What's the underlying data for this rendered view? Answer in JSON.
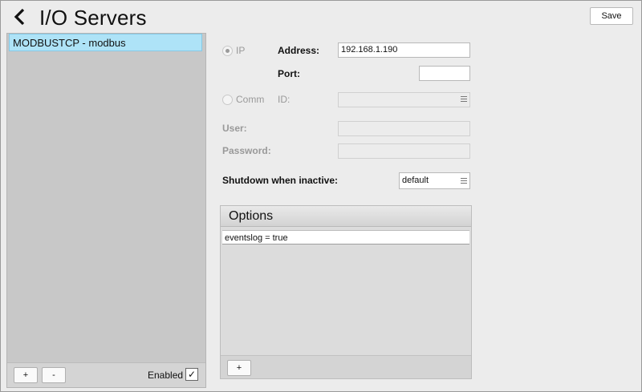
{
  "header": {
    "title": "I/O Servers",
    "save_label": "Save"
  },
  "servers": [
    {
      "label": "MODBUSTCP - modbus",
      "selected": true
    }
  ],
  "left_footer": {
    "add_label": "+",
    "remove_label": "-",
    "enabled_label": "Enabled",
    "enabled_check": "✓"
  },
  "connection": {
    "ip_label": "IP",
    "address_label": "Address:",
    "address_value": "192.168.1.190",
    "port_label": "Port:",
    "port_value": "",
    "comm_label": "Comm",
    "id_label": "ID:",
    "id_value": ""
  },
  "credentials": {
    "user_label": "User:",
    "user_value": "",
    "password_label": "Password:",
    "password_value": ""
  },
  "shutdown": {
    "label": "Shutdown when inactive:",
    "value": "default"
  },
  "options": {
    "title": "Options",
    "items": [
      "eventslog = true"
    ],
    "add_label": "+"
  }
}
